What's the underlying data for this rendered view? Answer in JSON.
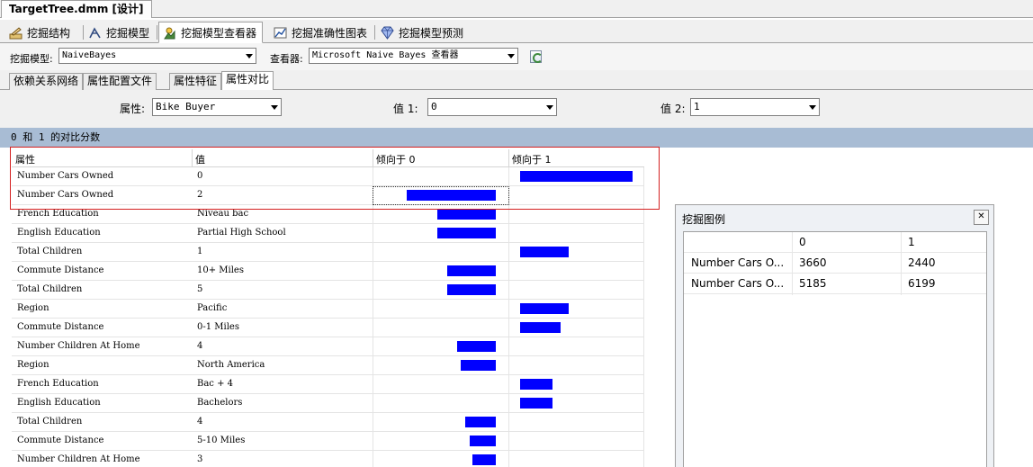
{
  "document_tab": {
    "title": "TargetTree.dmm [设计]"
  },
  "designer_tabs": [
    {
      "label": "挖掘结构",
      "icon": "mining-structure-icon",
      "active": false
    },
    {
      "label": "挖掘模型",
      "icon": "mining-models-icon",
      "active": false
    },
    {
      "label": "挖掘模型查看器",
      "icon": "mining-model-viewer-icon",
      "active": true
    },
    {
      "label": "挖掘准确性图表",
      "icon": "accuracy-chart-icon",
      "active": false
    },
    {
      "label": "挖掘模型预测",
      "icon": "prediction-diamond-icon",
      "active": false
    }
  ],
  "toolbar": {
    "model_label": "挖掘模型:",
    "model_value": "NaiveBayes",
    "viewer_label": "查看器:",
    "viewer_value": "Microsoft Naive Bayes 查看器",
    "refresh_icon": "refresh-icon"
  },
  "sub_tabs": [
    {
      "label": "依赖关系网络",
      "active": false
    },
    {
      "label": "属性配置文件",
      "active": false
    },
    {
      "label": "属性特征",
      "active": false
    },
    {
      "label": "属性对比",
      "active": true
    }
  ],
  "selectors": {
    "attribute_label": "属性:",
    "attribute_value": "Bike Buyer",
    "value1_label": "值 1:",
    "value1_value": "0",
    "value2_label": "值 2:",
    "value2_value": "1"
  },
  "score_title": "0 和 1 的对比分数",
  "grid": {
    "headers": {
      "attribute": "属性",
      "value": "值",
      "favors0": "倾向于 0",
      "favors1": "倾向于 1"
    },
    "rows": [
      {
        "attribute": "Number Cars Owned",
        "value": "0",
        "favors": 1,
        "score": 100
      },
      {
        "attribute": "Number Cars Owned",
        "value": "2",
        "favors": 0,
        "score": 79
      },
      {
        "attribute": "French Education",
        "value": "Niveau bac",
        "favors": 0,
        "score": 52
      },
      {
        "attribute": "English Education",
        "value": "Partial High School",
        "favors": 0,
        "score": 52
      },
      {
        "attribute": "Total Children",
        "value": "1",
        "favors": 1,
        "score": 43
      },
      {
        "attribute": "Commute Distance",
        "value": "10+ Miles",
        "favors": 0,
        "score": 43
      },
      {
        "attribute": "Total Children",
        "value": "5",
        "favors": 0,
        "score": 43
      },
      {
        "attribute": "Region",
        "value": "Pacific",
        "favors": 1,
        "score": 43
      },
      {
        "attribute": "Commute Distance",
        "value": "0-1 Miles",
        "favors": 1,
        "score": 36
      },
      {
        "attribute": "Number Children At Home",
        "value": "4",
        "favors": 0,
        "score": 34
      },
      {
        "attribute": "Region",
        "value": "North America",
        "favors": 0,
        "score": 31
      },
      {
        "attribute": "French Education",
        "value": "Bac + 4",
        "favors": 1,
        "score": 29
      },
      {
        "attribute": "English Education",
        "value": "Bachelors",
        "favors": 1,
        "score": 29
      },
      {
        "attribute": "Total Children",
        "value": "4",
        "favors": 0,
        "score": 27
      },
      {
        "attribute": "Commute Distance",
        "value": "5-10 Miles",
        "favors": 0,
        "score": 23
      },
      {
        "attribute": "Number Children At Home",
        "value": "3",
        "favors": 0,
        "score": 21
      }
    ]
  },
  "legend": {
    "title": "挖掘图例",
    "close_icon": "close-icon",
    "columns": [
      "",
      "0",
      "1"
    ],
    "rows": [
      {
        "label": "Number Cars O...",
        "v0": "3660",
        "v1": "2440"
      },
      {
        "label": "Number Cars O...",
        "v0": "5185",
        "v1": "6199"
      }
    ]
  },
  "colors": {
    "bar": "#0000ff",
    "score_bar": "#a8bcd4",
    "highlight": "#d42020"
  }
}
